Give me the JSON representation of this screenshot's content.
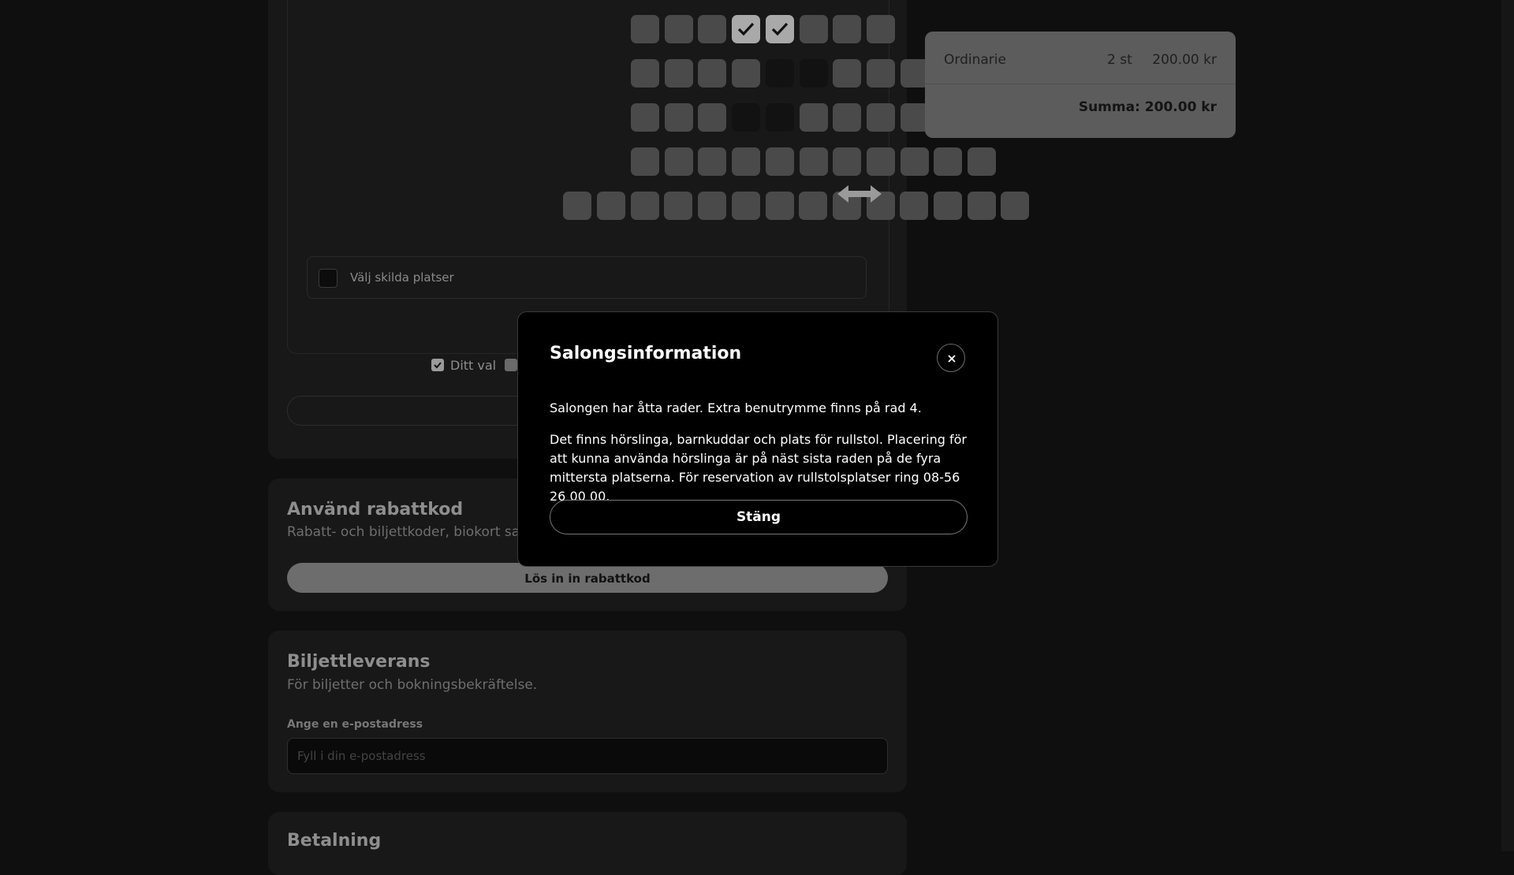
{
  "seat_map": {
    "rows": [
      {
        "seats": [
          "free",
          "free",
          "free",
          "selected",
          "selected",
          "free",
          "free",
          "free"
        ]
      },
      {
        "seats": [
          "free",
          "free",
          "free",
          "free",
          "taken",
          "taken",
          "free",
          "free",
          "free",
          "free",
          "free"
        ]
      },
      {
        "seats": [
          "free",
          "free",
          "free",
          "taken",
          "taken",
          "free",
          "free",
          "free",
          "free",
          "free",
          "free"
        ]
      },
      {
        "seats": [
          "free",
          "free",
          "free",
          "free",
          "free",
          "free",
          "free",
          "free",
          "free",
          "free",
          "free"
        ]
      },
      {
        "seats": [
          "free",
          "free",
          "free",
          "free",
          "free",
          "free",
          "free",
          "free",
          "free",
          "free",
          "free",
          "free",
          "free",
          "free"
        ]
      }
    ],
    "separate_seats_label": "Välj skilda platser",
    "legend_selected": "Ditt val"
  },
  "discount": {
    "title": "Använd rabattkod",
    "subtitle": "Rabatt- och biljettkoder, biokort samt",
    "button": "Lös in in rabattkod"
  },
  "delivery": {
    "title": "Biljettleverans",
    "subtitle": "För biljetter och bokningsbekräftelse.",
    "email_label": "Ange en e-postadress",
    "email_placeholder": "Fyll i din e-postadress"
  },
  "payment": {
    "title": "Betalning"
  },
  "summary": {
    "ticket_type": "Ordinarie",
    "quantity": "2 st",
    "price": "200.00 kr",
    "total": "Summa: 200.00 kr"
  },
  "modal": {
    "title": "Salongsinformation",
    "paragraph1": "Salongen har åtta rader. Extra benutrymme finns på rad 4.",
    "paragraph2": "Det finns hörslinga, barnkuddar och plats för rullstol. Placering för att kunna använda hörslinga är på näst sista raden på de fyra mittersta platserna. För reservation av rullstolsplatser ring 08-56 26 00 00.",
    "close_button": "Stäng"
  }
}
